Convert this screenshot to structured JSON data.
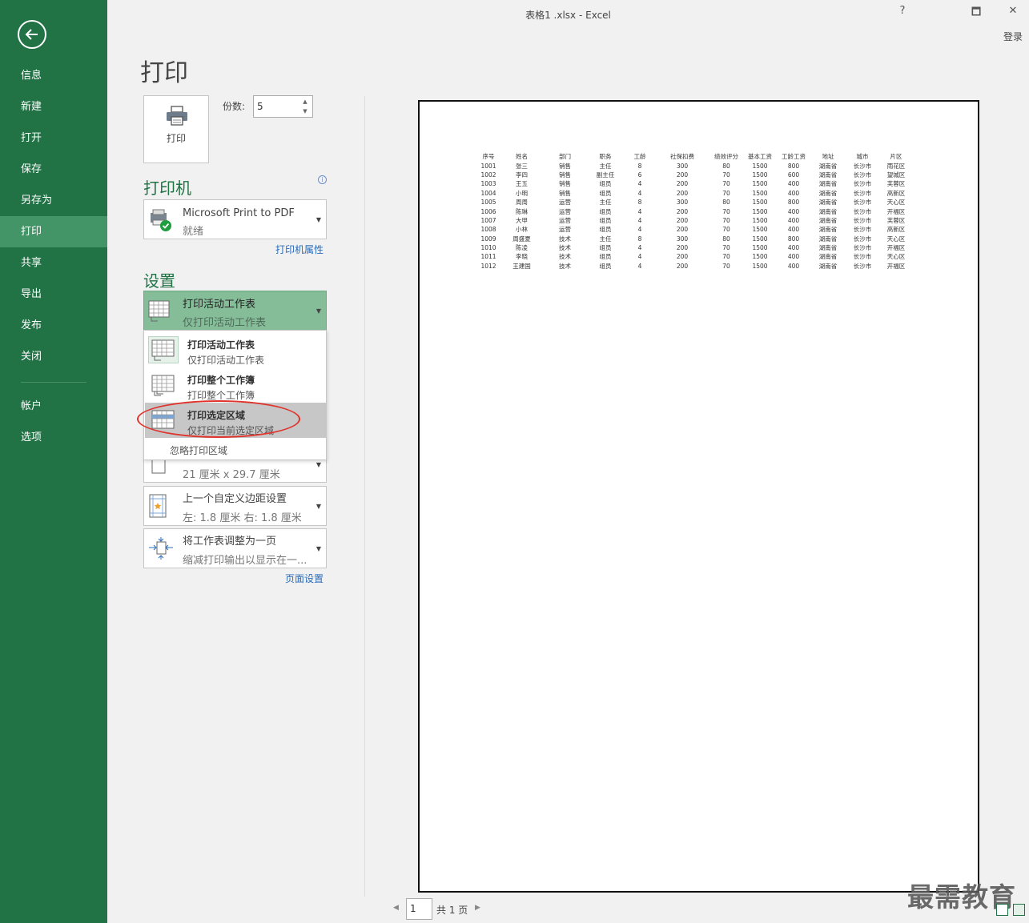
{
  "window": {
    "title": "表格1 .xlsx  -  Excel",
    "help": "?",
    "restore": "🗖",
    "close": "✕",
    "login": "登录"
  },
  "sidebar": {
    "back_icon": "back-arrow-icon",
    "items": [
      {
        "label": "信息"
      },
      {
        "label": "新建"
      },
      {
        "label": "打开"
      },
      {
        "label": "保存"
      },
      {
        "label": "另存为"
      },
      {
        "label": "打印",
        "active": true
      },
      {
        "label": "共享"
      },
      {
        "label": "导出"
      },
      {
        "label": "发布"
      },
      {
        "label": "关闭"
      }
    ],
    "bottom_items": [
      {
        "label": "帐户"
      },
      {
        "label": "选项"
      }
    ],
    "bg_color": "#217346",
    "active_color": "#439467"
  },
  "print": {
    "title": "打印",
    "button_label": "打印",
    "copies_label": "份数:",
    "copies_value": "5"
  },
  "printer": {
    "section_title": "打印机",
    "name": "Microsoft Print to PDF",
    "status": "就绪",
    "properties_link": "打印机属性"
  },
  "settings": {
    "section_title": "设置",
    "scope": {
      "line1": "打印活动工作表",
      "line2": "仅打印活动工作表"
    },
    "menu": [
      {
        "line1": "打印活动工作表",
        "line2": "仅打印活动工作表"
      },
      {
        "line1": "打印整个工作簿",
        "line2": "打印整个工作簿"
      },
      {
        "line1": "打印选定区域",
        "line2": "仅打印当前选定区域",
        "highlighted": true
      }
    ],
    "ignore_print_area": "忽略打印区域",
    "paper_size": "21 厘米 x 29.7 厘米",
    "margins": {
      "line1": "上一个自定义边距设置",
      "line2": "左:  1.8 厘米     右:  1.8 厘米"
    },
    "scaling": {
      "line1": "将工作表调整为一页",
      "line2": "缩减打印输出以显示在一..."
    },
    "page_setup_link": "页面设置"
  },
  "preview": {
    "headers": [
      "序号",
      "姓名",
      "部门",
      "职务",
      "工龄",
      "社保扣费",
      "绩效评分",
      "基本工资",
      "工龄工资",
      "地址",
      "城市",
      "片区"
    ],
    "rows": [
      [
        "1001",
        "张三",
        "销售",
        "主任",
        "8",
        "300",
        "80",
        "1500",
        "800",
        "湖南省",
        "长沙市",
        "雨花区"
      ],
      [
        "1002",
        "李四",
        "销售",
        "副主任",
        "6",
        "200",
        "70",
        "1500",
        "600",
        "湖南省",
        "长沙市",
        "望城区"
      ],
      [
        "1003",
        "王五",
        "销售",
        "组员",
        "4",
        "200",
        "70",
        "1500",
        "400",
        "湖南省",
        "长沙市",
        "芙蓉区"
      ],
      [
        "1004",
        "小明",
        "销售",
        "组员",
        "4",
        "200",
        "70",
        "1500",
        "400",
        "湖南省",
        "长沙市",
        "高新区"
      ],
      [
        "1005",
        "周周",
        "运营",
        "主任",
        "8",
        "300",
        "80",
        "1500",
        "800",
        "湖南省",
        "长沙市",
        "天心区"
      ],
      [
        "1006",
        "陈琳",
        "运营",
        "组员",
        "4",
        "200",
        "70",
        "1500",
        "400",
        "湖南省",
        "长沙市",
        "开福区"
      ],
      [
        "1007",
        "大甲",
        "运营",
        "组员",
        "4",
        "200",
        "70",
        "1500",
        "400",
        "湖南省",
        "长沙市",
        "芙蓉区"
      ],
      [
        "1008",
        "小林",
        "运营",
        "组员",
        "4",
        "200",
        "70",
        "1500",
        "400",
        "湖南省",
        "长沙市",
        "高新区"
      ],
      [
        "1009",
        "周盛夏",
        "技术",
        "主任",
        "8",
        "300",
        "80",
        "1500",
        "800",
        "湖南省",
        "长沙市",
        "天心区"
      ],
      [
        "1010",
        "陈凌",
        "技术",
        "组员",
        "4",
        "200",
        "70",
        "1500",
        "400",
        "湖南省",
        "长沙市",
        "开福区"
      ],
      [
        "1011",
        "李晓",
        "技术",
        "组员",
        "4",
        "200",
        "70",
        "1500",
        "400",
        "湖南省",
        "长沙市",
        "天心区"
      ],
      [
        "1012",
        "王建国",
        "技术",
        "组员",
        "4",
        "200",
        "70",
        "1500",
        "400",
        "湖南省",
        "长沙市",
        "开福区"
      ]
    ]
  },
  "pager": {
    "current": "1",
    "total": "共 1 页"
  },
  "watermark": "最需教育"
}
